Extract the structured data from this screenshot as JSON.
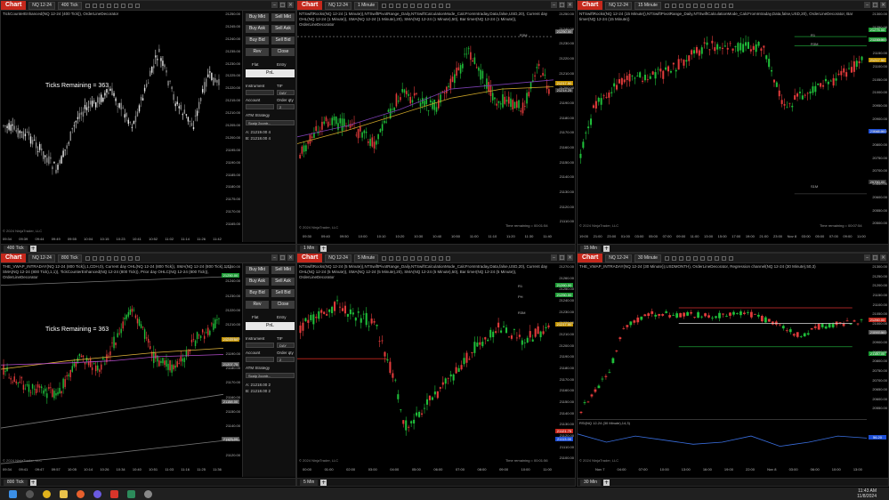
{
  "chart_button_label": "Chart",
  "windows": {
    "w1": {
      "instrument": "NQ 12-24",
      "interval": "400 Tick",
      "indicators": "TickCounterEnhanced(NQ 12-24 (400 Tick)), OrderLineDecorator",
      "overlay_text": "Ticks Remaining = 363",
      "price_labels": [
        "21250.00",
        "21245.00",
        "21240.00",
        "21235.00",
        "21230.00",
        "21225.00",
        "21220.00",
        "21215.00",
        "21210.00",
        "21205.00",
        "21200.00",
        "21195.00",
        "21190.00",
        "21185.00",
        "21180.00",
        "21175.00",
        "21170.00",
        "21165.00"
      ],
      "time_labels": [
        "09:34",
        "09:39",
        "09:44",
        "09:49",
        "09:55",
        "10:04",
        "10:15",
        "10:23",
        "10:41",
        "10:52",
        "11:02",
        "11:14",
        "11:26",
        "11:42"
      ],
      "copyright": "© 2024 NinjaTrader, LLC",
      "tab": "400 Tick"
    },
    "w2": {
      "instrument": "NQ 12-24",
      "interval": "1 Minute",
      "indicators": "NTSwiftRocks(NQ 12-24 (1 Minute)),NTSwiftPivotRange_Daily,NTSwiftCalculationMode_CalcFromIntraday,Data,false,USD,20), Current day OHL(NQ 12-24 (1 Minute)), SMA(NQ 12-24 (1 Minute),20), SMA(NQ 12-24 (1 Minute),50), Bar timer(NQ 12-24 (1 Minute)), OrderLineDecorator",
      "price_labels": [
        "21250.00",
        "21240.00",
        "21230.00",
        "21220.00",
        "21210.00",
        "21200.00",
        "21190.00",
        "21180.00",
        "21170.00",
        "21160.00",
        "21150.00",
        "21140.00",
        "21130.00",
        "21120.00",
        "21110.00"
      ],
      "time_labels": [
        "09:30",
        "09:40",
        "09:50",
        "10:00",
        "10:10",
        "10:20",
        "10:30",
        "10:40",
        "10:50",
        "11:00",
        "11:10",
        "11:20",
        "11:30",
        "11:40"
      ],
      "copyright": "© 2024 NinjaTrader, LLC",
      "remaining": "Time remaining = 00:01:54",
      "tab": "1 Min",
      "level_text": "R3M"
    },
    "w3": {
      "instrument": "NQ 12-24",
      "interval": "15 Minute",
      "indicators": "NTSwiftRocks(NQ 12-24 (15 Minute)),NTSwiftPivotRange_Daily,NTSwiftCalculationMode_CalcFromIntraday,Data,false,USD,20), OrderLineDecorator, Bar timer(NQ 12-24 (15 Minute))",
      "price_labels": [
        "21300.00",
        "21250.00",
        "21200.00",
        "21150.00",
        "21100.00",
        "21050.00",
        "21000.00",
        "20950.00",
        "20900.00",
        "20850.00",
        "20800.00",
        "20750.00",
        "20700.00",
        "20650.00",
        "20600.00",
        "20550.00",
        "20500.00"
      ],
      "time_labels": [
        "19:00",
        "21:00",
        "23:00",
        "01:00",
        "03:00",
        "05:00",
        "07:00",
        "09:00",
        "11:00",
        "13:00",
        "15:00",
        "17:00",
        "19:00",
        "21:00",
        "23:00",
        "Nov 8",
        "03:00",
        "05:00",
        "07:00",
        "09:00",
        "11:00"
      ],
      "copyright": "© 2024 NinjaTrader, LLC",
      "remaining": "Time remaining = 00:07:54",
      "tab": "15 Min",
      "level_texts": [
        "R1",
        "R3M",
        "S1M"
      ]
    },
    "w4": {
      "instrument": "NQ 12-24",
      "interval": "800 Tick",
      "indicators": "THE_VWAP_INTRADAY(NQ 12-24 (800 Tick)),1,CDH,0), Current day OHL(NQ 12-24 (800 Tick)), SMA(NQ 12-24 (800 Tick),1,1), SMA(NQ 12-24 (800 Tick),1,1)), TickCounterEnhanced(NQ 12-24 (800 Tick)), Prior day OHLC(NQ 12-24 (800 Tick)), OrderLineDecorator",
      "overlay_text": "Ticks Remaining = 363",
      "price_labels": [
        "21250.00",
        "21240.00",
        "21230.00",
        "21220.00",
        "21210.00",
        "21200.00",
        "21190.00",
        "21180.00",
        "21170.00",
        "21160.00",
        "21150.00",
        "21140.00",
        "21130.00",
        "21120.00"
      ],
      "time_labels": [
        "09:34",
        "09:41",
        "09:47",
        "09:57",
        "10:05",
        "10:14",
        "10:26",
        "10:34",
        "10:40",
        "10:51",
        "11:03",
        "11:16",
        "11:25",
        "11:36"
      ],
      "copyright": "© 2024 NinjaTrader, LLC",
      "tab": "800 Tick"
    },
    "w5": {
      "instrument": "NQ 12-24",
      "interval": "5 Minute",
      "indicators": "NTSwiftRocks(NQ 12-24 (5 Minute)),NTSwiftPivotRange_Daily,NTSwiftCalculationMode_CalcFromIntraday,Data,false,USD,20), Current day OHL(NQ 12-24 (5 Minute)), SMA(NQ 12-24 (5 Minute),20), SMA(NQ 12-24 (5 Minute),50), Bar timer(NQ 12-24 (5 Minute)), OrderLineDecorator",
      "price_labels": [
        "21270.00",
        "21260.00",
        "21250.00",
        "21240.00",
        "21230.00",
        "21220.00",
        "21210.00",
        "21200.00",
        "21190.00",
        "21180.00",
        "21170.00",
        "21160.00",
        "21150.00",
        "21140.00",
        "21130.00",
        "21120.00",
        "21110.00",
        "21100.00"
      ],
      "time_labels": [
        "00:00",
        "01:00",
        "02:00",
        "03:00",
        "04:00",
        "05:00",
        "06:00",
        "07:00",
        "08:00",
        "09:00",
        "10:00",
        "11:00"
      ],
      "copyright": "© 2024 NinjaTrader, LLC",
      "remaining": "Time remaining = 00:01:56",
      "tab": "5 Min",
      "level_texts": [
        "R1",
        "PH",
        "R3M"
      ]
    },
    "w6": {
      "instrument": "NQ 12-24",
      "interval": "30 Minute",
      "indicators": "THE_VWAP_INTRADAY(NQ 12-24 (30 Minute)),USDMONTH), OrderLineDecorator, Regression channel(NQ 12-24 (30 Minute),50,3)",
      "rsi_label": "RSI(NQ 12-24 (30 Minute),14,3)",
      "price_labels": [
        "21300.00",
        "21250.00",
        "21200.00",
        "21150.00",
        "21100.00",
        "21050.00",
        "21000.00",
        "20950.00",
        "20900.00",
        "20850.00",
        "20800.00",
        "20750.00",
        "20700.00",
        "20650.00",
        "20600.00",
        "20550.00"
      ],
      "time_labels": [
        "Nov 7",
        "04:00",
        "07:00",
        "10:00",
        "13:00",
        "16:00",
        "19:00",
        "22:00",
        "Nov 8",
        "03:00",
        "06:00",
        "10:00",
        "13:00"
      ],
      "copyright": "© 2024 NinjaTrader, LLC",
      "tab": "30 Min"
    }
  },
  "chart_trader": {
    "buttons": [
      "Buy Mkt",
      "Sell Mkt",
      "Buy Ask",
      "Sell Ask",
      "Buy Bid",
      "Sell Bid",
      "Rev",
      "Close"
    ],
    "flat_label": "Flat",
    "entry_label": "Entry",
    "pnl_label": "PnL",
    "instrument_label": "Instrument",
    "tif_label": "TIF",
    "tif_value": "DAY",
    "account_label": "Account",
    "order_qty_label": "Order qty",
    "order_qty_value": "2",
    "atm_label": "ATM Strategy",
    "atm_value": "Scalp 2contr...",
    "a_top": "A: 21219.00  4",
    "b_top": "B: 21218.00  4",
    "a_bottom": "A: 21218.00  2",
    "b_bottom": "B: 21218.00  2"
  },
  "colors": {
    "up": "#1fbf3a",
    "down": "#e23b3b",
    "neutral": "#d9d9d9",
    "accent": "#c5281c"
  },
  "taskbar": {
    "time": "11:43 AM",
    "date": "11/8/2024"
  }
}
